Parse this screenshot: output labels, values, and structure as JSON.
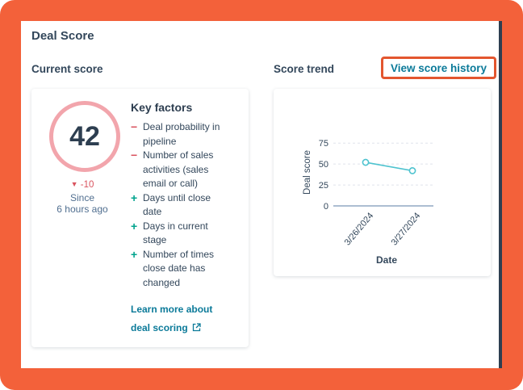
{
  "widget": {
    "title": "Deal Score",
    "current_score_label": "Current score",
    "score_trend_label": "Score trend",
    "view_history_label": "View score history"
  },
  "score": {
    "value": "42",
    "delta": "-10",
    "since_line1": "Since",
    "since_line2": "6 hours ago"
  },
  "key_factors": {
    "title": "Key factors",
    "items": [
      {
        "sign": "−",
        "lines": [
          "Deal probability in",
          "pipeline"
        ]
      },
      {
        "sign": "−",
        "lines": [
          "Number of sales",
          "activities (sales",
          "email or call)"
        ]
      },
      {
        "sign": "+",
        "lines": [
          "Days until close",
          "date"
        ]
      },
      {
        "sign": "+",
        "lines": [
          "Days in current",
          "stage"
        ]
      },
      {
        "sign": "+",
        "lines": [
          "Number of times",
          "close date has",
          "changed"
        ]
      }
    ],
    "learn_more_line1": "Learn more about",
    "learn_more_line2": "deal scoring"
  },
  "icons": {
    "external_link": "external-link-icon",
    "delta_down": "caret-down-icon"
  },
  "colors": {
    "accent_link": "#0b7a99",
    "negative": "#d9535e",
    "positive": "#00a38d",
    "score_ring": "#f2a5ac",
    "series_line": "#4ec3cf",
    "highlight_border": "#e3562f"
  },
  "chart_data": {
    "type": "line",
    "x": [
      "3/26/2024",
      "3/27/2024"
    ],
    "series": [
      {
        "values": [
          52,
          42
        ]
      }
    ],
    "xlabel": "Date",
    "ylabel": "Deal score",
    "yticks": [
      0,
      25,
      50,
      75
    ],
    "ylim": [
      0,
      80
    ],
    "grid": true
  }
}
